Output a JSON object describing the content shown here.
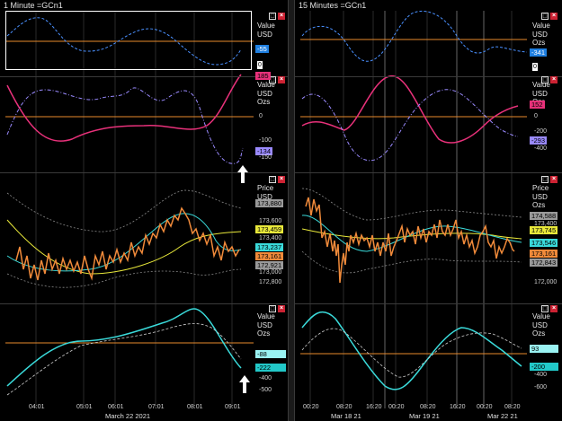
{
  "left": {
    "title": "1 Minute =GCn1",
    "panels": [
      {
        "hdr": "Value\nUSD",
        "tag": "-55",
        "ticks": []
      },
      {
        "hdr": "Value\nUSD\nOzs",
        "tag1": "185",
        "tag2": "-134",
        "ticks": [
          "0",
          "-100",
          "-150"
        ]
      },
      {
        "hdr": "Price\nUSD\nOzs",
        "tags": [
          "173,880",
          "173,459",
          "173,237",
          "173,161",
          "172,921"
        ],
        "ticks": [
          "173,600",
          "173,400",
          "173,000",
          "172,800"
        ]
      },
      {
        "hdr": "Value\nUSD\nOzs",
        "tag1": "-88",
        "tag2": "-222",
        "ticks": [
          "-400",
          "-500"
        ]
      }
    ],
    "x_ticks": [
      "04:01",
      "05:01",
      "06:01",
      "07:01",
      "08:01",
      "09:01"
    ],
    "date": "March 22 2021"
  },
  "right": {
    "title": "15 Minutes =GCn1",
    "panels": [
      {
        "hdr": "Value\nUSD\nOzs",
        "tag": "-341",
        "ticks": []
      },
      {
        "hdr": "Value\nUSD\nOzs",
        "tag1": "152",
        "tag2": "-293",
        "ticks": [
          "0",
          "-200",
          "-400"
        ]
      },
      {
        "hdr": "Price\nUSD\nOzs",
        "tags": [
          "174,588",
          "173,745",
          "173,546",
          "173,161",
          "172,843"
        ],
        "ticks": [
          "173,400",
          "172,000"
        ]
      },
      {
        "hdr": "Value\nUSD\nOzs",
        "tag1": "93",
        "tag2": "-200",
        "ticks": [
          "-400",
          "-600"
        ]
      }
    ],
    "x_ticks": [
      "00:20",
      "08:20",
      "16:20",
      "00:20",
      "08:20",
      "16:20",
      "00:20",
      "08:20"
    ],
    "dates": [
      "Mar 18 21",
      "Mar 19 21",
      "Mar 22 21"
    ]
  },
  "zero_label": "0",
  "btn_max": "□",
  "btn_close": "×"
}
